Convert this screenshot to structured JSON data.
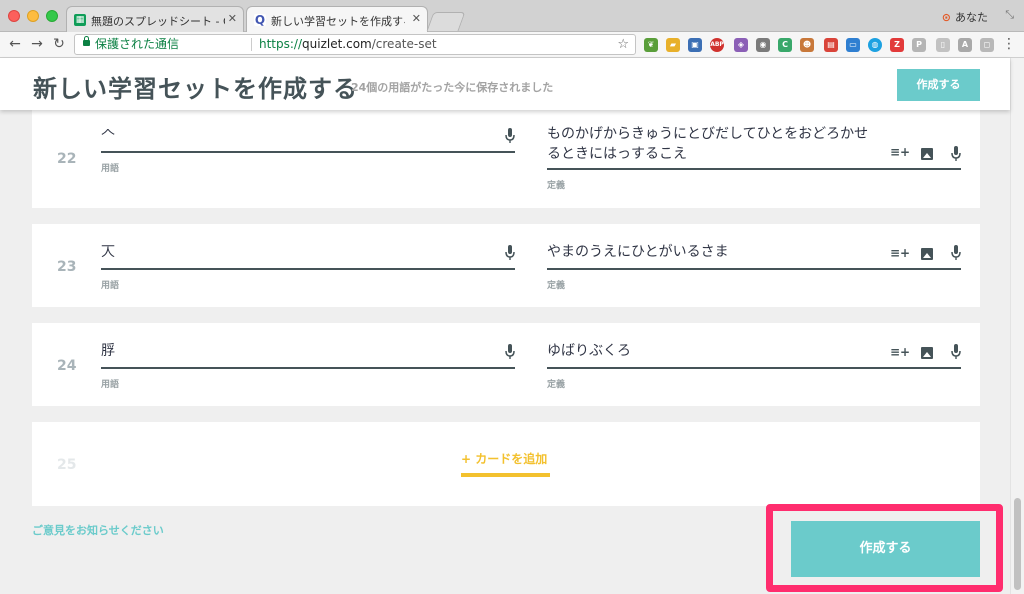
{
  "browser": {
    "tabs": [
      {
        "title": "無題のスプレッドシート - Goo",
        "icon": "google-sheets-icon",
        "color": "#0f9d58"
      },
      {
        "title": "新しい学習セットを作成する | Q",
        "icon": "quizlet-icon",
        "color": "#4257b2"
      }
    ],
    "profile_name": "あなた",
    "secure_label": "保護された通信",
    "url_protocol": "https://",
    "url_host": "quizlet.com",
    "url_path": "/create-set"
  },
  "header": {
    "title": "新しい学習セットを作成する",
    "save_status": "24個の用語がたった今に保存されました",
    "create_button": "作成する"
  },
  "cards": [
    {
      "number": "22",
      "term": "𠆢",
      "term_label": "用語",
      "definition": "ものかげからきゅうにとびだしてひとをおどろかせるときにはっするこえ",
      "definition_label": "定義"
    },
    {
      "number": "23",
      "term": "𠆣",
      "term_label": "用語",
      "definition": "やまのうえにひとがいるさま",
      "definition_label": "定義"
    },
    {
      "number": "24",
      "term": "脬",
      "term_label": "用語",
      "definition": "ゆばりぶくろ",
      "definition_label": "定義"
    }
  ],
  "add_card": {
    "number": "25",
    "label": "+ カードを追加"
  },
  "footer": {
    "feedback_link": "ご意見をお知らせください",
    "create_button": "作成する"
  },
  "colors": {
    "accent": "#6bcbcb",
    "add_card": "#f3c12e",
    "highlight": "#ff2d6e",
    "text_dark": "#455358"
  }
}
